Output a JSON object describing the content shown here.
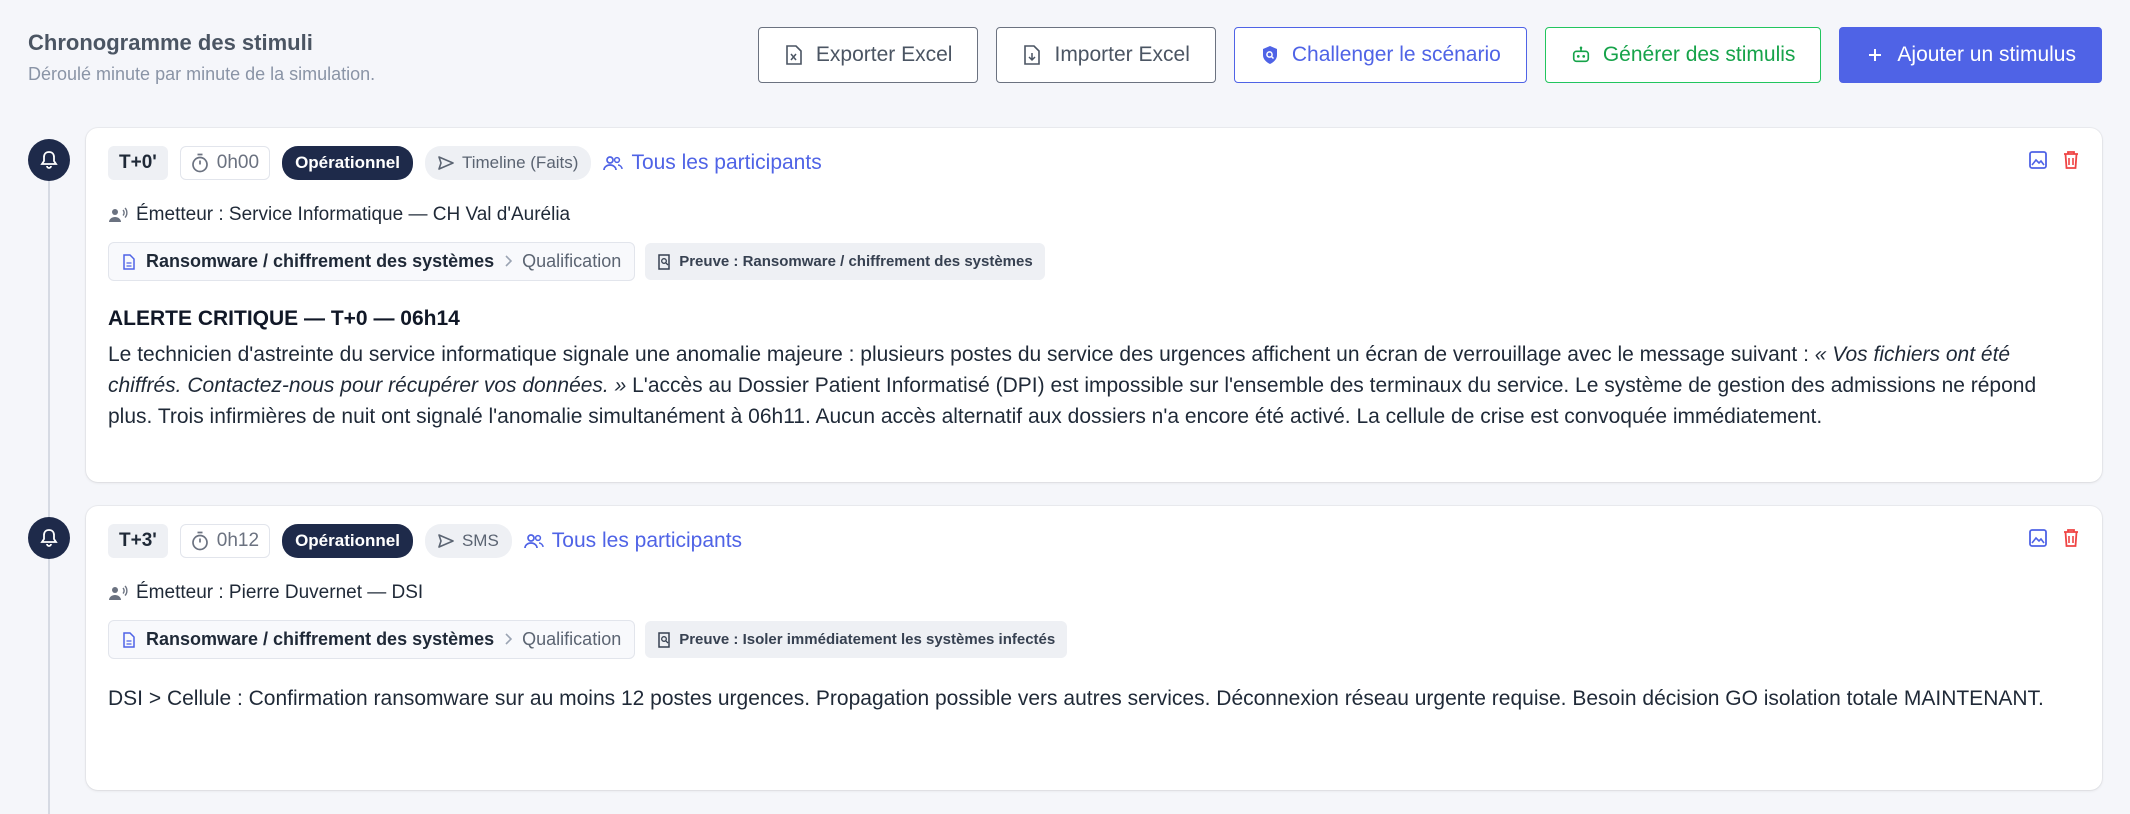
{
  "header": {
    "title": "Chronogramme des stimuli",
    "subtitle": "Déroulé minute par minute de la simulation."
  },
  "actions": {
    "export": "Exporter Excel",
    "import": "Importer Excel",
    "challenge": "Challenger le scénario",
    "generate": "Générer des stimulis",
    "add": "Ajouter un stimulus"
  },
  "colors": {
    "primary": "#4f63e6",
    "green": "#16a34a",
    "navy": "#1e2a4a",
    "danger": "#ef4444"
  },
  "stimuli": [
    {
      "t": "T+0'",
      "time": "0h00",
      "category": "Opérationnel",
      "channel": "Timeline (Faits)",
      "audience": "Tous les participants",
      "emitter": "Émetteur : Service Informatique — CH Val d'Aurélia",
      "path_main": "Ransomware / chiffrement des systèmes",
      "path_sub": "Qualification",
      "proof": "Preuve : Ransomware / chiffrement des systèmes",
      "title": "ALERTE CRITIQUE — T+0 — 06h14",
      "body_1": "Le technicien d'astreinte du service informatique signale une anomalie majeure : plusieurs postes du service des urgences affichent un écran de verrouillage avec le message suivant : ",
      "body_quote": "« Vos fichiers ont été chiffrés. Contactez-nous pour récupérer vos données. »",
      "body_2": " L'accès au Dossier Patient Informatisé (DPI) est impossible sur l'ensemble des terminaux du service. Le système de gestion des admissions ne répond plus. Trois infirmières de nuit ont signalé l'anomalie simultanément à 06h11. Aucun accès alternatif aux dossiers n'a encore été activé. La cellule de crise est convoquée immédiatement."
    },
    {
      "t": "T+3'",
      "time": "0h12",
      "category": "Opérationnel",
      "channel": "SMS",
      "audience": "Tous les participants",
      "emitter": "Émetteur : Pierre Duvernet — DSI",
      "path_main": "Ransomware / chiffrement des systèmes",
      "path_sub": "Qualification",
      "proof": "Preuve : Isoler immédiatement les systèmes infectés",
      "body": "DSI > Cellule : Confirmation ransomware sur au moins 12 postes urgences. Propagation possible vers autres services. Déconnexion réseau urgente requise. Besoin décision GO isolation totale MAINTENANT."
    }
  ]
}
